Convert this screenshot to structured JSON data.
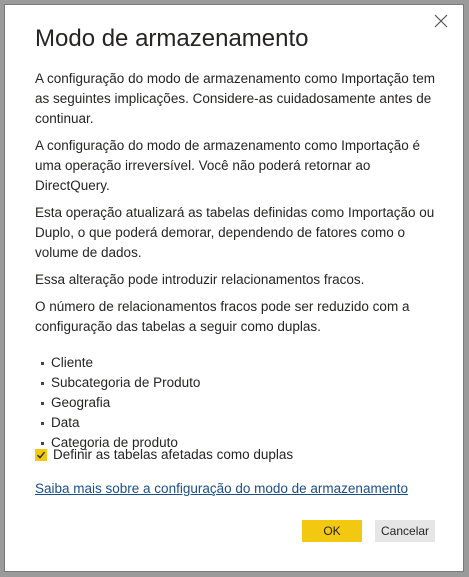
{
  "dialog": {
    "title": "Modo de armazenamento",
    "paragraphs": [
      "A configuração do modo de armazenamento como Importação tem as seguintes implicações. Considere-as cuidadosamente antes de continuar.",
      "A configuração do modo de armazenamento como Importação é uma operação irreversível. Você não poderá retornar ao DirectQuery.",
      "Esta operação atualizará as tabelas definidas como Importação ou Duplo, o que poderá demorar, dependendo de fatores como o volume de dados.",
      "Essa alteração pode introduzir relacionamentos fracos.",
      "O número de relacionamentos fracos pode ser reduzido com a configuração das tabelas a seguir como duplas."
    ],
    "tables": [
      "Cliente",
      "Subcategoria de Produto",
      "Geografia",
      "Data",
      "Categoria de produto"
    ],
    "checkbox": {
      "label": "Definir as tabelas afetadas como duplas",
      "checked": true
    },
    "link": "Saiba mais sobre a configuração do modo de armazenamento",
    "ok_label": "OK",
    "cancel_label": "Cancelar",
    "close_icon": "close-icon"
  },
  "colors": {
    "accent": "#f2c811",
    "link": "#1a4e8a",
    "cancel_bg": "#e6e6e6"
  }
}
